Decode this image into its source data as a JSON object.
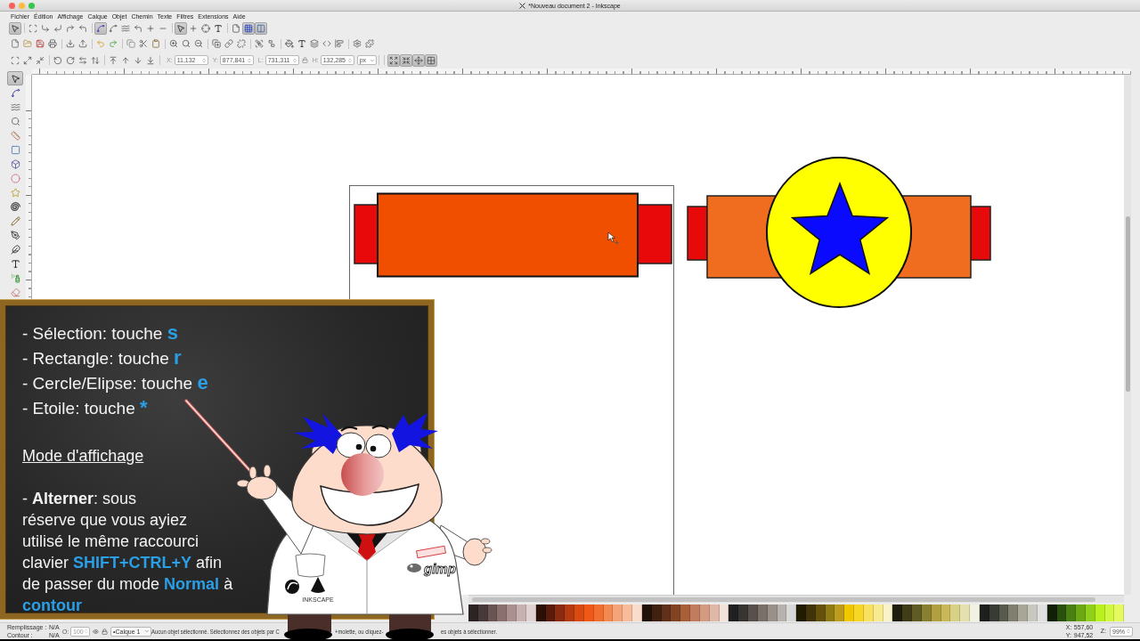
{
  "window": {
    "title": "*Nouveau document 2 - Inkscape"
  },
  "menu": [
    "Fichier",
    "Édition",
    "Affichage",
    "Calque",
    "Objet",
    "Chemin",
    "Texte",
    "Filtres",
    "Extensions",
    "Aide"
  ],
  "snap_toolbar": [
    [
      {
        "kind": "pointer",
        "on": true
      }
    ],
    [
      {
        "kind": "bbox",
        "on": false
      },
      {
        "kind": "edge",
        "on": false
      },
      {
        "kind": "corner-dl",
        "on": false
      },
      {
        "kind": "corner-ur",
        "on": false
      },
      {
        "kind": "corner-ul",
        "on": false
      }
    ],
    [
      {
        "kind": "node",
        "on": true
      },
      {
        "kind": "smooth",
        "on": false
      },
      {
        "kind": "path",
        "on": false
      },
      {
        "kind": "cusp",
        "on": false
      },
      {
        "kind": "intersection",
        "on": false
      },
      {
        "kind": "line",
        "on": false
      }
    ],
    [
      {
        "kind": "pointer",
        "on": true
      },
      {
        "kind": "plus",
        "on": false
      },
      {
        "kind": "center",
        "on": false
      },
      {
        "kind": "text",
        "on": false
      }
    ],
    [
      {
        "kind": "page",
        "on": false
      },
      {
        "kind": "grid",
        "on": true
      },
      {
        "kind": "guide",
        "on": true
      }
    ]
  ],
  "commands_toolbar": [
    [
      {
        "kind": "new"
      },
      {
        "kind": "open"
      },
      {
        "kind": "save"
      },
      {
        "kind": "print"
      }
    ],
    [
      {
        "kind": "import"
      },
      {
        "kind": "export"
      }
    ],
    [
      {
        "kind": "undo"
      },
      {
        "kind": "redo"
      }
    ],
    [
      {
        "kind": "copy"
      },
      {
        "kind": "cut"
      },
      {
        "kind": "paste"
      }
    ],
    [
      {
        "kind": "zoom-in"
      },
      {
        "kind": "zoom-fit"
      },
      {
        "kind": "zoom-out"
      }
    ],
    [
      {
        "kind": "duplicate"
      },
      {
        "kind": "clone"
      },
      {
        "kind": "unlink"
      }
    ],
    [
      {
        "kind": "group"
      },
      {
        "kind": "ungroup"
      }
    ],
    [
      {
        "kind": "fill"
      },
      {
        "kind": "text"
      },
      {
        "kind": "layers"
      },
      {
        "kind": "xml"
      },
      {
        "kind": "align"
      }
    ],
    [
      {
        "kind": "prefs"
      },
      {
        "kind": "extension"
      }
    ]
  ],
  "selector_toolbar": {
    "groups": [
      [
        {
          "kind": "select-all"
        },
        {
          "kind": "select-all-layers"
        },
        {
          "kind": "deselect"
        }
      ],
      [
        {
          "kind": "rotate-ccw"
        },
        {
          "kind": "rotate-cw"
        },
        {
          "kind": "flip-h"
        },
        {
          "kind": "flip-v"
        }
      ],
      [
        {
          "kind": "raise-top"
        },
        {
          "kind": "raise"
        },
        {
          "kind": "lower"
        },
        {
          "kind": "lower-bottom"
        }
      ]
    ],
    "controls": [
      {
        "kind": "field",
        "label": "X:",
        "value": "11,132"
      },
      {
        "kind": "field",
        "label": "Y:",
        "value": "877,841"
      },
      {
        "kind": "field",
        "label": "L:",
        "value": "731,311"
      },
      {
        "kind": "lock"
      },
      {
        "kind": "field",
        "label": "H:",
        "value": "132,285"
      },
      {
        "kind": "unit",
        "value": "px"
      }
    ],
    "toggles": [
      {
        "kind": "scale-stroke",
        "on": true
      },
      {
        "kind": "scale-corners",
        "on": true
      },
      {
        "kind": "move-gradients",
        "on": true
      },
      {
        "kind": "move-patterns",
        "on": true
      }
    ]
  },
  "toolbox": [
    {
      "kind": "pointer",
      "selected": true
    },
    {
      "kind": "node",
      "selected": false
    },
    {
      "kind": "tweak",
      "selected": false
    },
    {
      "kind": "zoom",
      "selected": false
    },
    {
      "kind": "measure",
      "selected": false
    },
    {
      "kind": "rect",
      "selected": false
    },
    {
      "kind": "box3d",
      "selected": false
    },
    {
      "kind": "ellipse",
      "selected": false
    },
    {
      "kind": "star",
      "selected": false
    },
    {
      "kind": "spiral",
      "selected": false
    },
    {
      "kind": "pencil",
      "selected": false
    },
    {
      "kind": "pen",
      "selected": false
    },
    {
      "kind": "calligraphy",
      "selected": false
    },
    {
      "kind": "text",
      "selected": false
    },
    {
      "kind": "spray",
      "selected": false
    },
    {
      "kind": "eraser",
      "selected": false
    }
  ],
  "chalkboard": {
    "shortcuts": [
      {
        "text": "- Sélection: touche",
        "key": "s"
      },
      {
        "text": "- Rectangle: touche",
        "key": "r"
      },
      {
        "text": "- Cercle/Elipse: touche",
        "key": "e"
      },
      {
        "text": "- Etoile: touche",
        "key": "*"
      }
    ],
    "heading": "Mode d'affichage",
    "paragraph": [
      {
        "kind": "plain",
        "text": "- "
      },
      {
        "kind": "bold",
        "text": "Alterner"
      },
      {
        "kind": "plain",
        "text": ": sous\nréserve que vous ayiez\nutilisé le même raccourci\nclavier "
      },
      {
        "kind": "key",
        "text": "SHIFT+CTRL+Y"
      },
      {
        "kind": "plain",
        "text": " afin\nde passer du mode "
      },
      {
        "kind": "key",
        "text": "Normal"
      },
      {
        "kind": "plain",
        "text": " à\n"
      },
      {
        "kind": "key",
        "text": "contour"
      }
    ]
  },
  "character": {
    "coat_labels": [
      {
        "kind": "inkscape",
        "text": "INKSCAPE"
      },
      {
        "kind": "gimp",
        "text": "gimp"
      }
    ]
  },
  "palette": [
    {
      "color": "#2c2424"
    },
    {
      "color": "#483a3a"
    },
    {
      "color": "#6a5454"
    },
    {
      "color": "#8c7070"
    },
    {
      "color": "#ab9090"
    },
    {
      "color": "#c7b1b1"
    },
    {
      "color": "#e0d2d2"
    },
    {
      "color": "#2a1006"
    },
    {
      "color": "#5a1c0a"
    },
    {
      "color": "#8a2a0e"
    },
    {
      "color": "#b43a10"
    },
    {
      "color": "#d84a10"
    },
    {
      "color": "#f05818"
    },
    {
      "color": "#f06e30"
    },
    {
      "color": "#f28a50"
    },
    {
      "color": "#f4a478"
    },
    {
      "color": "#f6bc9c"
    },
    {
      "color": "#fadccc"
    },
    {
      "color": "#201208"
    },
    {
      "color": "#40200e"
    },
    {
      "color": "#603018"
    },
    {
      "color": "#804422"
    },
    {
      "color": "#a86038"
    },
    {
      "color": "#c07c5c"
    },
    {
      "color": "#d29a80"
    },
    {
      "color": "#e0b8a8"
    },
    {
      "color": "#f2e2d8"
    },
    {
      "color": "#202020"
    },
    {
      "color": "#383432"
    },
    {
      "color": "#58504c"
    },
    {
      "color": "#7a706a"
    },
    {
      "color": "#9a908a"
    },
    {
      "color": "#b8b2ae"
    },
    {
      "color": "#d8d8d8"
    },
    {
      "color": "#201c04"
    },
    {
      "color": "#403408"
    },
    {
      "color": "#64520c"
    },
    {
      "color": "#907a14"
    },
    {
      "color": "#bc9c1c"
    },
    {
      "color": "#f0c800"
    },
    {
      "color": "#f8d628"
    },
    {
      "color": "#f8e060"
    },
    {
      "color": "#f8ea90"
    },
    {
      "color": "#faf2c8"
    },
    {
      "color": "#201e0c"
    },
    {
      "color": "#403c18"
    },
    {
      "color": "#605a24"
    },
    {
      "color": "#888030"
    },
    {
      "color": "#b0a040"
    },
    {
      "color": "#c8b858"
    },
    {
      "color": "#d8d084"
    },
    {
      "color": "#e4e0b0"
    },
    {
      "color": "#f2f2e2"
    },
    {
      "color": "#1e1e1e"
    },
    {
      "color": "#383a34"
    },
    {
      "color": "#585a4e"
    },
    {
      "color": "#807e6e"
    },
    {
      "color": "#a8a696"
    },
    {
      "color": "#c8c8c0"
    },
    {
      "color": "#e0e0e0"
    },
    {
      "color": "#102008"
    },
    {
      "color": "#2a5010"
    },
    {
      "color": "#4a8010"
    },
    {
      "color": "#6ca814"
    },
    {
      "color": "#90d018"
    },
    {
      "color": "#b8f020"
    },
    {
      "color": "#d0f840"
    },
    {
      "color": "#e4fa60"
    }
  ],
  "status_bar": {
    "style": [
      {
        "label": "Remplissage :",
        "value": "N/A"
      },
      {
        "label": "Contour :",
        "value": "N/A"
      }
    ],
    "opacity": {
      "label": "O:",
      "value": "100",
      "disabled": true
    },
    "layer": "•Calque 1",
    "message_parts": [
      "Aucun objet sélectionné. Sélectionnez des objets par C",
      "+molette, ou cliquez-",
      "es objets à sélectionner."
    ],
    "cursor": [
      {
        "label": "X:",
        "value": "557,60"
      },
      {
        "label": "Y:",
        "value": "947,52"
      }
    ],
    "zoom": {
      "label": "Z:",
      "value": "99%"
    }
  }
}
